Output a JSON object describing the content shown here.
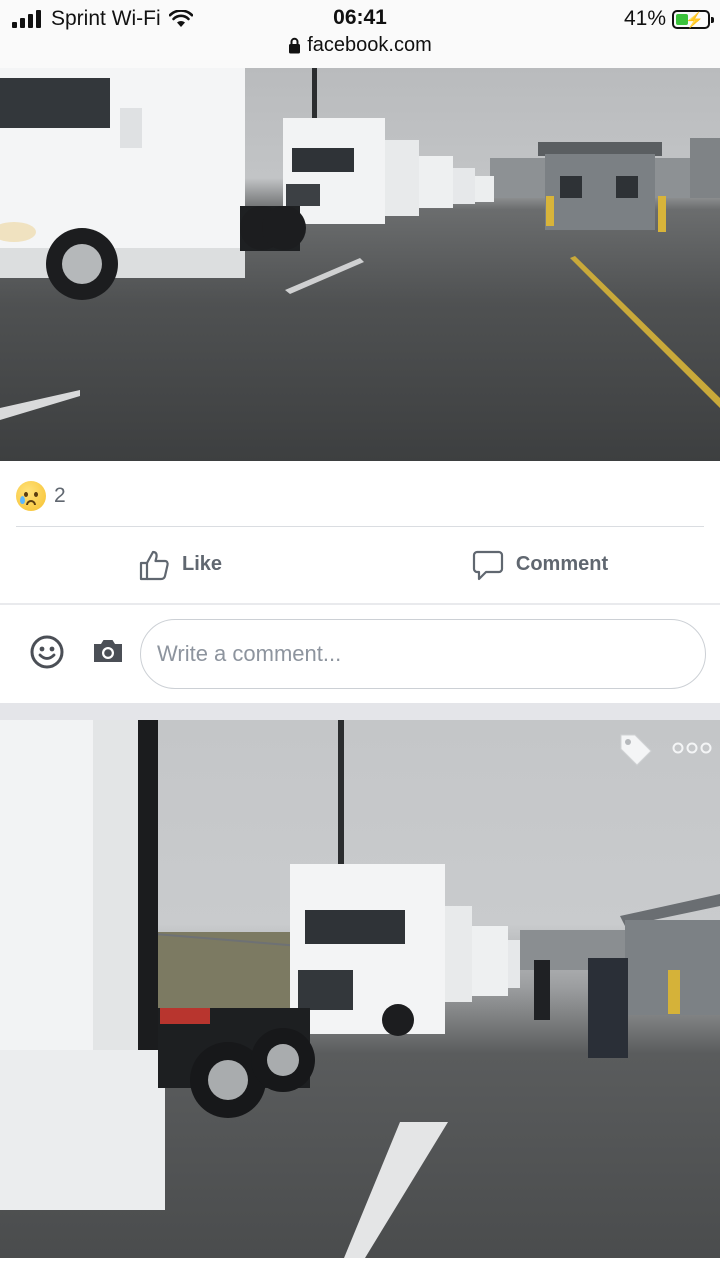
{
  "status_bar": {
    "carrier": "Sprint Wi-Fi",
    "time": "06:41",
    "battery_percent": "41%",
    "url": "facebook.com",
    "icons": [
      "signal-icon",
      "wifi-icon",
      "battery-charging-icon",
      "lock-icon"
    ]
  },
  "post": {
    "reaction": {
      "type": "sad",
      "count": "2"
    },
    "actions": {
      "like_label": "Like",
      "comment_label": "Comment"
    },
    "comment_box": {
      "placeholder": "Write a comment..."
    }
  },
  "second_photo": {
    "overlay_icons": [
      "tag-icon",
      "more-options-icon"
    ]
  },
  "colors": {
    "text_secondary": "#606770",
    "placeholder": "#8d949e",
    "divider": "#dadde1",
    "battery_green": "#3bc23b"
  }
}
